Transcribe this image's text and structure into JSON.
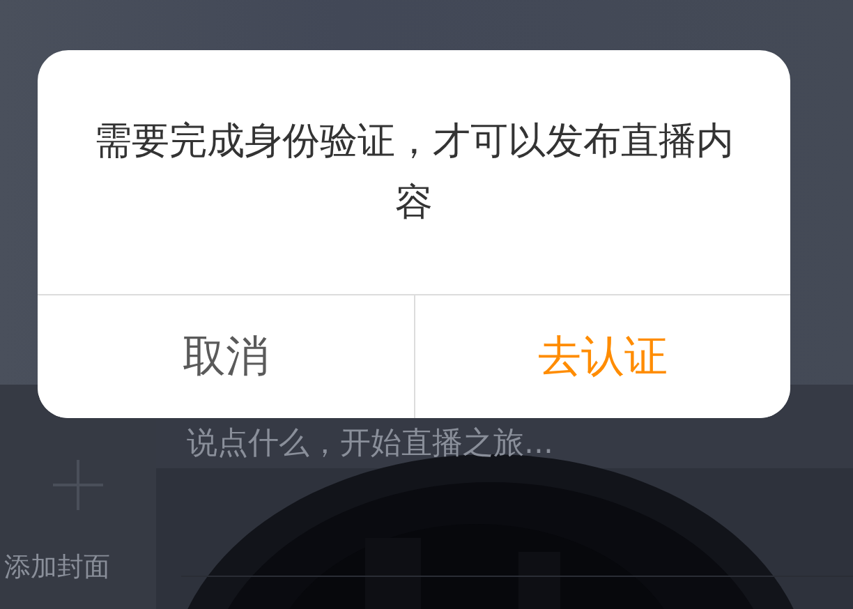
{
  "background": {
    "cover_button": {
      "label": "添加封面"
    },
    "title_input": {
      "placeholder": "说点什么，开始直播之旅..."
    }
  },
  "dialog": {
    "message": "需要完成身份验证，才可以发布直播内容",
    "buttons": [
      {
        "label": "取消",
        "kind": "cancel"
      },
      {
        "label": "去认证",
        "kind": "confirm"
      }
    ]
  }
}
